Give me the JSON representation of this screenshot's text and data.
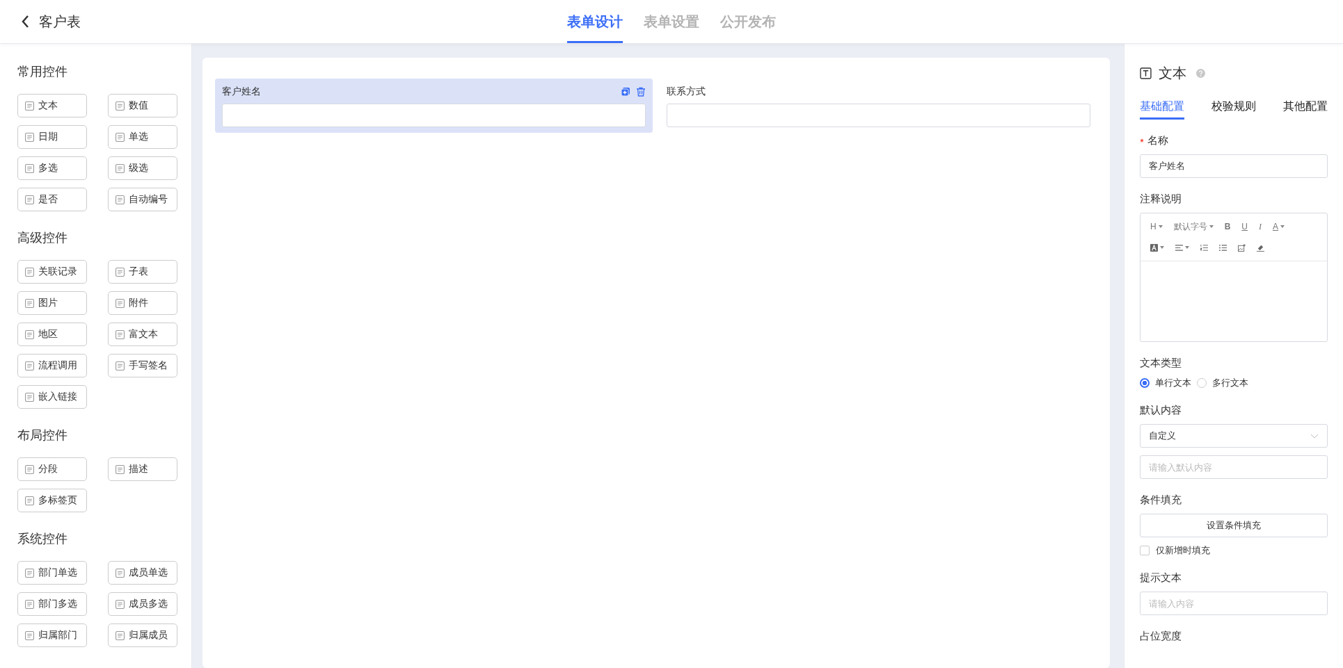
{
  "header": {
    "title": "客户表",
    "tabs": [
      {
        "label": "表单设计",
        "selected": true
      },
      {
        "label": "表单设置",
        "selected": false
      },
      {
        "label": "公开发布",
        "selected": false
      }
    ]
  },
  "palette": [
    {
      "title": "常用控件",
      "items": [
        "文本",
        "数值",
        "日期",
        "单选",
        "多选",
        "级选",
        "是否",
        "自动编号"
      ]
    },
    {
      "title": "高级控件",
      "items": [
        "关联记录",
        "子表",
        "图片",
        "附件",
        "地区",
        "富文本",
        "流程调用",
        "手写签名",
        "嵌入链接"
      ]
    },
    {
      "title": "布局控件",
      "items": [
        "分段",
        "描述",
        "多标签页"
      ]
    },
    {
      "title": "系统控件",
      "items": [
        "部门单选",
        "成员单选",
        "部门多选",
        "成员多选",
        "归属部门",
        "归属成员"
      ]
    }
  ],
  "canvas": {
    "fields": [
      {
        "label": "客户姓名",
        "selected": true
      },
      {
        "label": "联系方式",
        "selected": false
      }
    ]
  },
  "inspector": {
    "title": "文本",
    "tabs": [
      {
        "label": "基础配置",
        "selected": true
      },
      {
        "label": "校验规则",
        "selected": false
      },
      {
        "label": "其他配置",
        "selected": false
      }
    ],
    "name": {
      "label": "名称",
      "required": true,
      "value": "客户姓名"
    },
    "note": {
      "label": "注释说明",
      "toolbar_rows": [
        [
          {
            "kind": "heading",
            "label": "H",
            "dropdown": true
          },
          {
            "kind": "size",
            "label": "默认字号",
            "dropdown": true
          },
          {
            "kind": "bold",
            "label": "B"
          },
          {
            "kind": "underline",
            "label": "U"
          },
          {
            "kind": "italic",
            "label": "I"
          },
          {
            "kind": "color",
            "label": "A",
            "dropdown": true
          }
        ],
        [
          {
            "kind": "highlight",
            "dropdown": true
          },
          {
            "kind": "align",
            "dropdown": true
          },
          {
            "kind": "ordered"
          },
          {
            "kind": "bullet"
          },
          {
            "kind": "image"
          },
          {
            "kind": "eraser"
          }
        ]
      ]
    },
    "text_type": {
      "label": "文本类型",
      "options": [
        {
          "label": "单行文本",
          "selected": true
        },
        {
          "label": "多行文本",
          "selected": false
        }
      ]
    },
    "default": {
      "label": "默认内容",
      "value": "自定义",
      "placeholder": "请输入默认内容"
    },
    "condition": {
      "label": "条件填充",
      "button": "设置条件填充",
      "checkbox": {
        "label": "仅新增时填充",
        "checked": false
      }
    },
    "hint": {
      "label": "提示文本",
      "placeholder": "请输入内容"
    },
    "width_label": "占位宽度"
  }
}
